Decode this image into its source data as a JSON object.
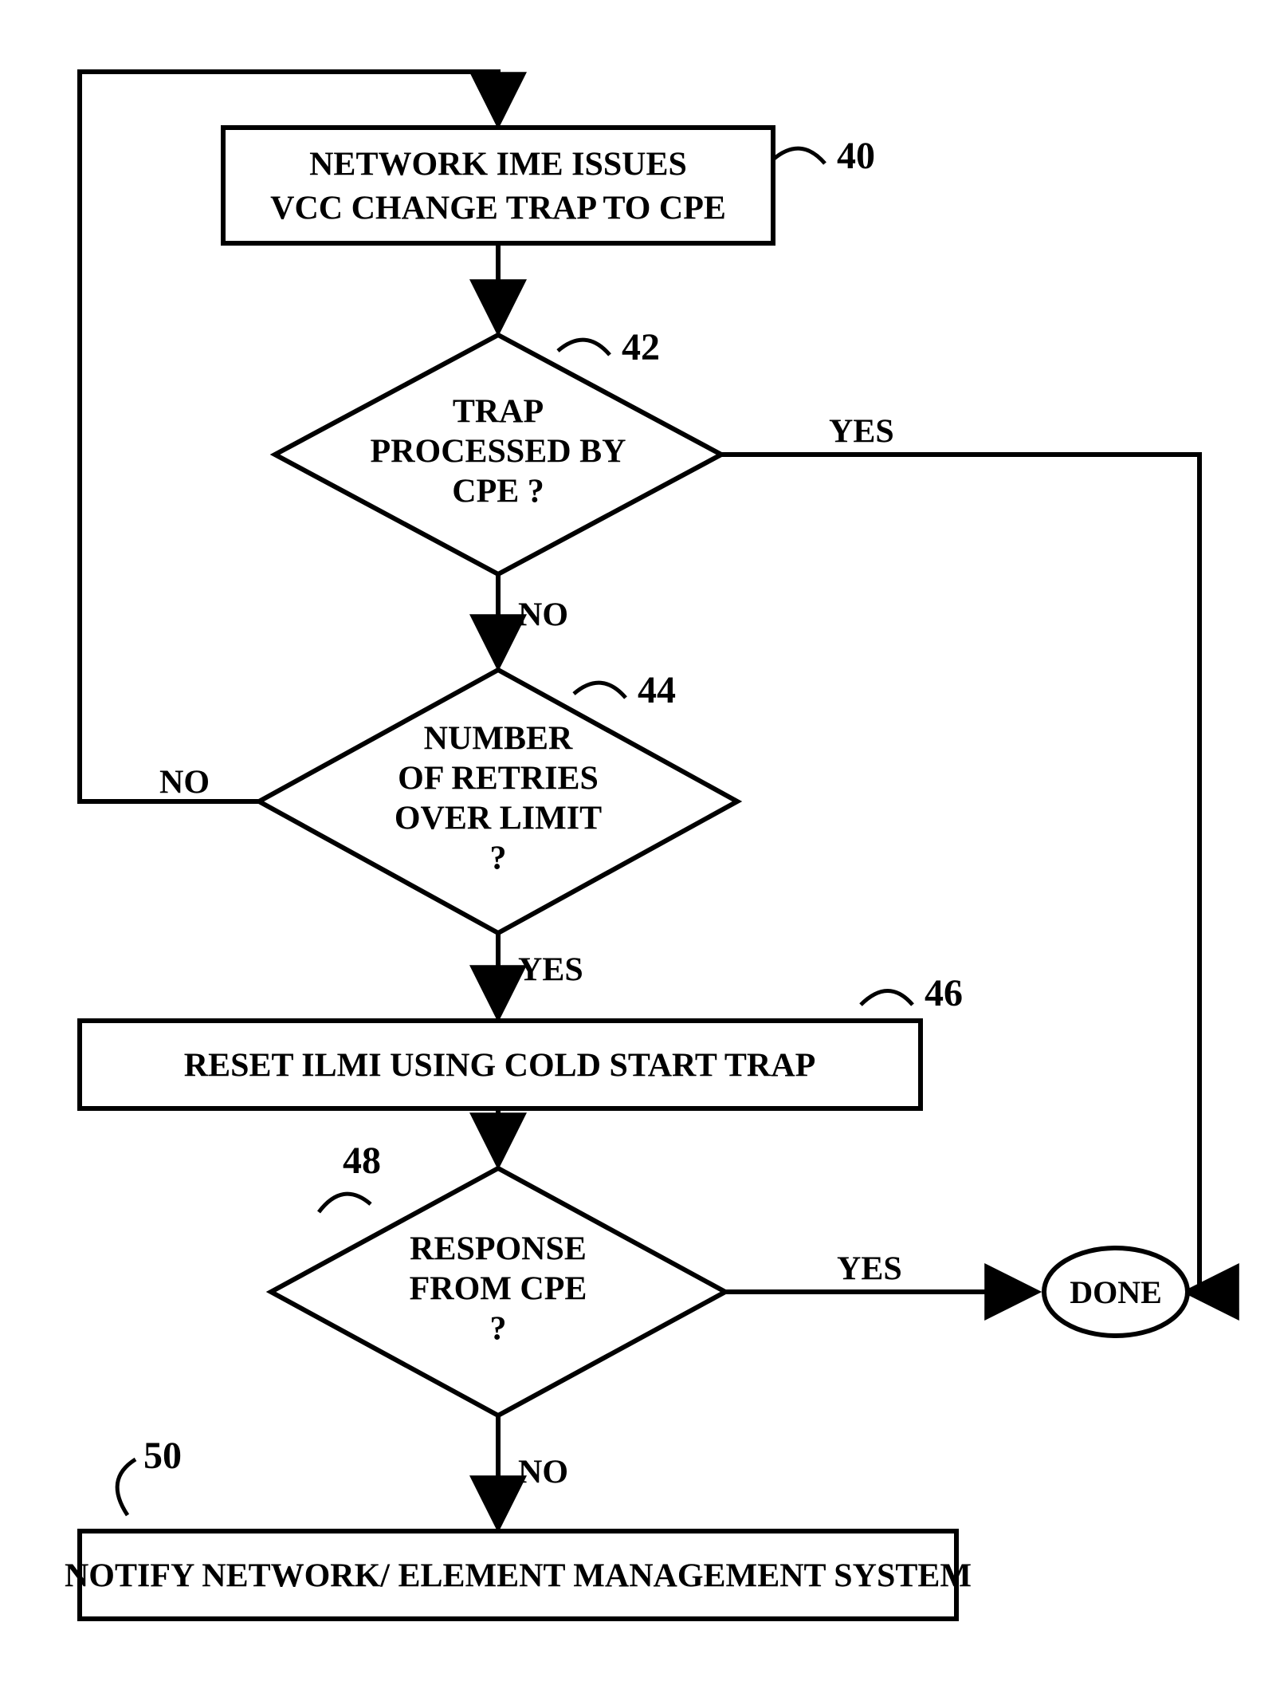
{
  "chart_data": {
    "type": "flowchart",
    "nodes": [
      {
        "id": "40",
        "type": "process",
        "text": [
          "NETWORK IME ISSUES",
          "VCC CHANGE TRAP TO CPE"
        ]
      },
      {
        "id": "42",
        "type": "decision",
        "text": [
          "TRAP",
          "PROCESSED BY",
          "CPE ?"
        ]
      },
      {
        "id": "44",
        "type": "decision",
        "text": [
          "NUMBER",
          "OF RETRIES",
          "OVER LIMIT",
          "?"
        ]
      },
      {
        "id": "46",
        "type": "process",
        "text": [
          "RESET ILMI USING COLD START TRAP"
        ]
      },
      {
        "id": "48",
        "type": "decision",
        "text": [
          "RESPONSE",
          "FROM CPE",
          "?"
        ]
      },
      {
        "id": "50",
        "type": "process",
        "text": [
          "NOTIFY NETWORK/ ELEMENT MANAGEMENT SYSTEM"
        ]
      },
      {
        "id": "done",
        "type": "terminator",
        "text": [
          "DONE"
        ]
      }
    ],
    "edges": [
      {
        "from": "40",
        "to": "42"
      },
      {
        "from": "42",
        "to": "44",
        "label": "NO"
      },
      {
        "from": "42",
        "to": "done",
        "label": "YES"
      },
      {
        "from": "44",
        "to": "40",
        "label": "NO"
      },
      {
        "from": "44",
        "to": "46",
        "label": "YES"
      },
      {
        "from": "46",
        "to": "48"
      },
      {
        "from": "48",
        "to": "done",
        "label": "YES"
      },
      {
        "from": "48",
        "to": "50",
        "label": "NO"
      }
    ]
  },
  "nodes": {
    "n40_l1": "NETWORK IME ISSUES",
    "n40_l2": "VCC CHANGE TRAP TO CPE",
    "n42_l1": "TRAP",
    "n42_l2": "PROCESSED BY",
    "n42_l3": "CPE ?",
    "n44_l1": "NUMBER",
    "n44_l2": "OF RETRIES",
    "n44_l3": "OVER LIMIT",
    "n44_l4": "?",
    "n46_l1": "RESET ILMI USING COLD START TRAP",
    "n48_l1": "RESPONSE",
    "n48_l2": "FROM CPE",
    "n48_l3": "?",
    "n50_l1": "NOTIFY NETWORK/ ELEMENT MANAGEMENT SYSTEM",
    "done": "DONE"
  },
  "refs": {
    "r40": "40",
    "r42": "42",
    "r44": "44",
    "r46": "46",
    "r48": "48",
    "r50": "50"
  },
  "labels": {
    "yes": "YES",
    "no": "NO"
  }
}
